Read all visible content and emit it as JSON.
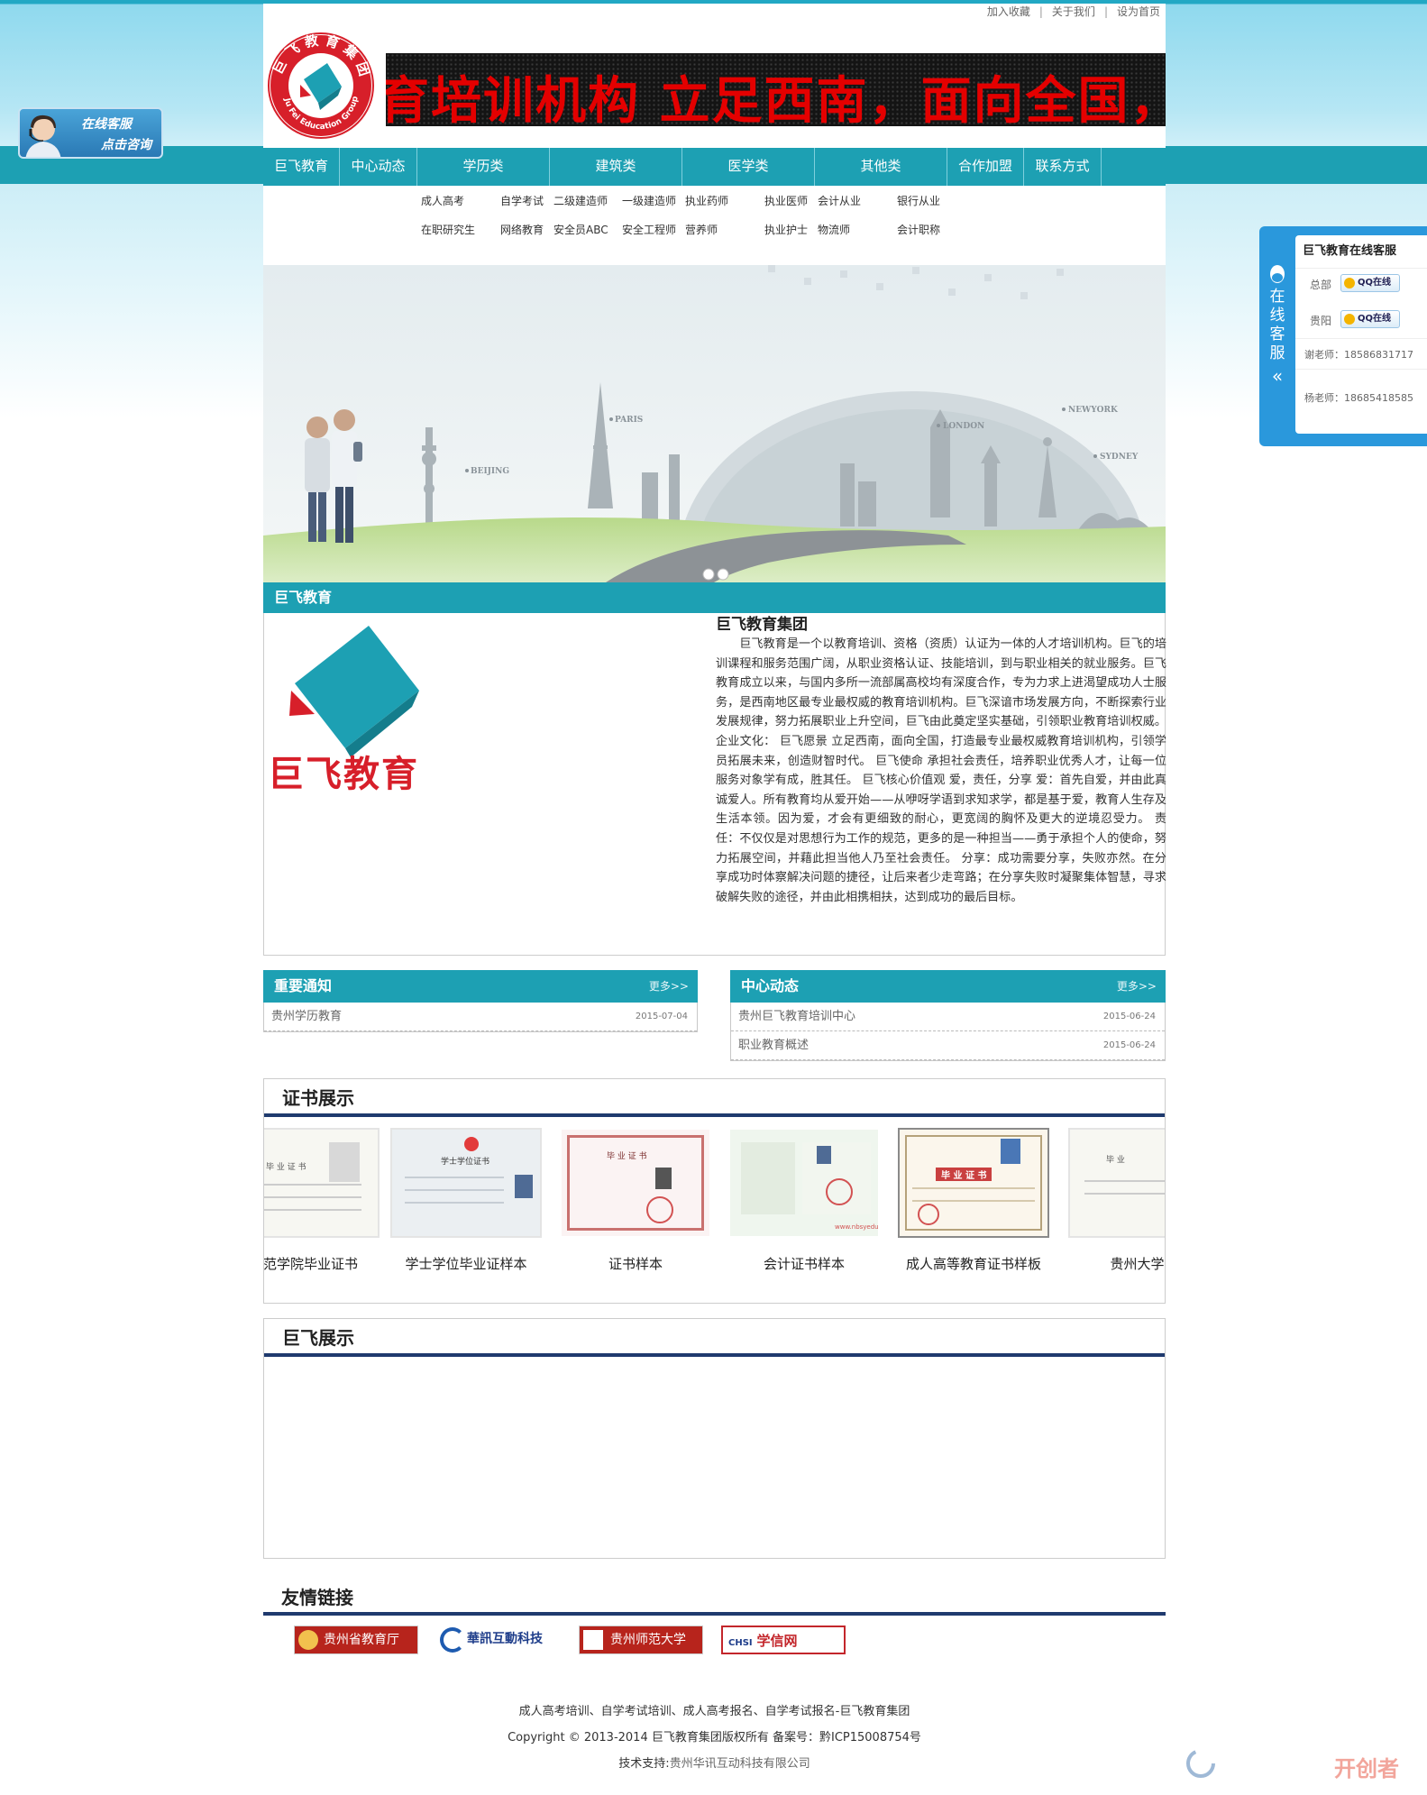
{
  "top_links": [
    "加入收藏",
    "关于我们",
    "设为首页"
  ],
  "ticker_text": "育培训机构  立足西南，面向全国，打造",
  "logo": {
    "ring_text": "巨飞教育集团",
    "en_text": "Ju Fei Education Group"
  },
  "nav": [
    "巨飞教育",
    "中心动态",
    "学历类",
    "建筑类",
    "医学类",
    "其他类",
    "合作加盟",
    "联系方式"
  ],
  "subnav": {
    "row1": [
      "成人高考",
      "自学考试",
      "二级建造师",
      "一级建造师",
      "执业药师",
      "执业医师",
      "会计从业",
      "银行从业"
    ],
    "row2": [
      "在职研究生",
      "网络教育",
      "安全员ABC",
      "安全工程师",
      "营养师",
      "执业护士",
      "物流师",
      "会计职称"
    ]
  },
  "banner": {
    "cities": [
      "PARIS",
      "LONDON",
      "NEWYORK",
      "BEIJING",
      "SYDNEY"
    ],
    "slide_count": 2
  },
  "about": {
    "section_title": "巨飞教育",
    "logo_text": "巨飞教育",
    "title": "巨飞教育集团",
    "body": "巨飞教育是一个以教育培训、资格（资质）认证为一体的人才培训机构。巨飞的培训课程和服务范围广阔，从职业资格认证、技能培训，到与职业相关的就业服务。巨飞教育成立以来，与国内多所一流部属高校均有深度合作，专为力求上进渴望成功人士服务，是西南地区最专业最权威的教育培训机构。巨飞深谙市场发展方向，不断探索行业发展规律，努力拓展职业上升空间，巨飞由此奠定坚实基础，引领职业教育培训权威。 企业文化： 巨飞愿景  立足西南，面向全国，打造最专业最权威教育培训机构，引领学员拓展未来，创造财智时代。 巨飞使命  承担社会责任，培养职业优秀人才，让每一位服务对象学有成，胜其任。 巨飞核心价值观  爱，责任，分享 爱：首先自爱，并由此真诚爱人。所有教育均从爱开始——从咿呀学语到求知求学，都是基于爱，教育人生存及生活本领。因为爱，才会有更细致的耐心，更宽阔的胸怀及更大的逆境忍受力。  责任：不仅仅是对思想行为工作的规范，更多的是一种担当——勇于承担个人的使命，努力拓展空间，并藉此担当他人乃至社会责任。  分享：成功需要分享，失败亦然。在分享成功时体察解决问题的捷径，让后来者少走弯路；在分享失败时凝聚集体智慧，寻求破解失败的途径，并由此相携相扶，达到成功的最后目标。"
  },
  "notice": {
    "title": "重要通知",
    "more": "更多>>",
    "items": [
      {
        "text": "贵州学历教育",
        "date": "2015-07-04"
      }
    ]
  },
  "center_news": {
    "title": "中心动态",
    "more": "更多>>",
    "items": [
      {
        "text": "贵州巨飞教育培训中心",
        "date": "2015-06-24"
      },
      {
        "text": "职业教育概述",
        "date": "2015-06-24"
      }
    ]
  },
  "certificates": {
    "title": "证书展示",
    "items": [
      {
        "caption": "师范学院毕业证书",
        "doc_title": "毕 业 证 书"
      },
      {
        "caption": "学士学位毕业证样本",
        "doc_title": "学士学位证书"
      },
      {
        "caption": "证书样本",
        "doc_title": "毕 业 证 书"
      },
      {
        "caption": "会计证书样本",
        "doc_title": ""
      },
      {
        "caption": "成人高等教育证书样板",
        "doc_title": "毕 业 证 书"
      },
      {
        "caption": "贵州大学毕",
        "doc_title": "毕 业"
      }
    ],
    "watermark": "www.nbsyedu.net"
  },
  "jufei_show": {
    "title": "巨飞展示"
  },
  "friend_links": {
    "title": "友情链接",
    "items": [
      "贵州省教育厅",
      "華訊互動科技",
      "贵州师范大学",
      "学信网"
    ],
    "chsi_prefix": "CHSI"
  },
  "footer": {
    "line1": "成人高考培训、自学考试培训、成人高考报名、自学考试报名-巨飞教育集团",
    "line2": "Copyright © 2013-2014 巨飞教育集团版权所有 备案号：黔ICP15008754号",
    "line3_label": "技术支持:",
    "line3_link": "贵州华讯互动科技有限公司"
  },
  "left_widget": {
    "line1": "在线客服",
    "line2": "点击咨询"
  },
  "right_widget": {
    "tab_text": "在线客服",
    "tab_arrow": "«",
    "title": "巨飞教育在线客服",
    "qq": [
      {
        "label": "总部",
        "btn": "QQ在线"
      },
      {
        "label": "贵阳",
        "btn": "QQ在线"
      }
    ],
    "phones": [
      "谢老师：18586831717",
      "杨老师：18685418585"
    ]
  },
  "corner_watermark": "开创者",
  "colors": {
    "teal": "#1da0b3",
    "navy": "#1f3a6e",
    "ticker_red": "#e40000",
    "logo_red": "#d71f2a"
  }
}
